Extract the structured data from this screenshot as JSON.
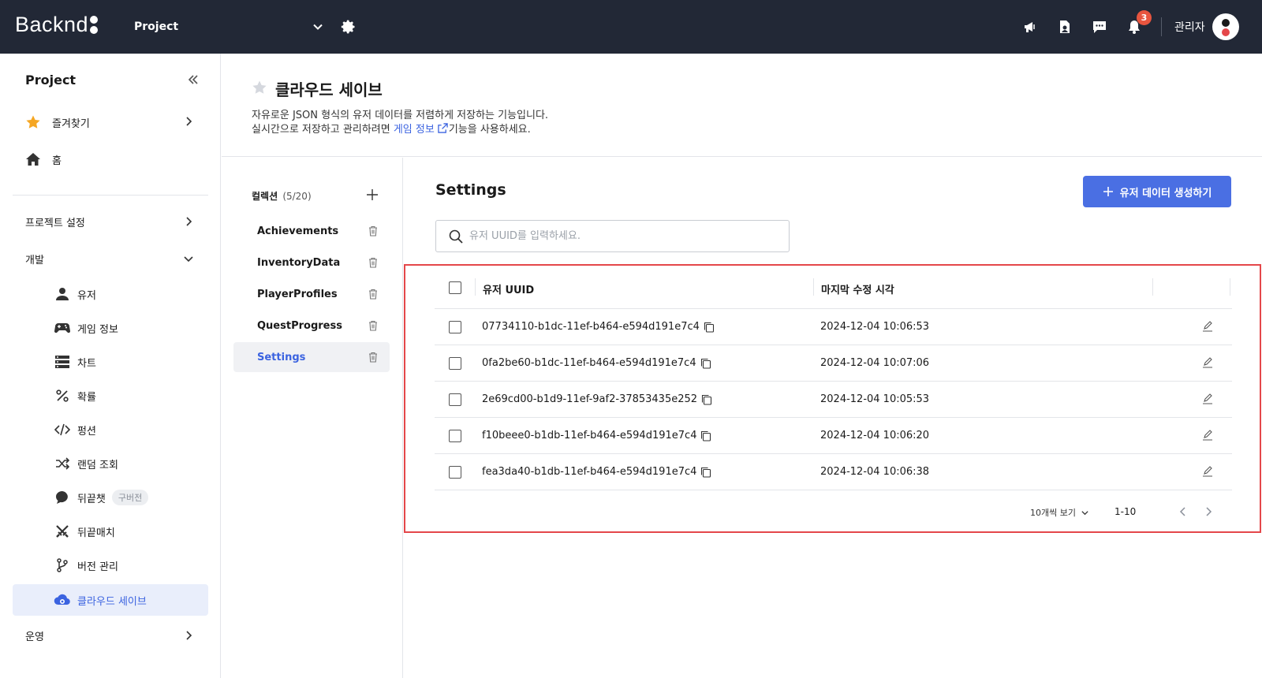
{
  "topbar": {
    "logo_text": "Backnd",
    "project_name": "Project",
    "notification_count": "3",
    "admin_label": "관리자"
  },
  "sidebar": {
    "title": "Project",
    "favorites": "즐겨찾기",
    "home": "홈",
    "project_settings": "프로젝트 설정",
    "dev_section": "개발",
    "dev_items": [
      {
        "label": "유저",
        "icon": "user-icon"
      },
      {
        "label": "게임 정보",
        "icon": "gamepad-icon"
      },
      {
        "label": "차트",
        "icon": "chart-icon"
      },
      {
        "label": "확률",
        "icon": "percent-icon"
      },
      {
        "label": "펑션",
        "icon": "code-icon"
      },
      {
        "label": "랜덤 조회",
        "icon": "shuffle-icon"
      },
      {
        "label": "뒤끝챗",
        "icon": "chat-bubble-icon",
        "badge": "구버전"
      },
      {
        "label": "뒤끝매치",
        "icon": "swords-icon"
      },
      {
        "label": "버전 관리",
        "icon": "branch-icon"
      },
      {
        "label": "클라우드 세이브",
        "icon": "cloud-icon",
        "active": true
      }
    ],
    "ops_section": "운영"
  },
  "page": {
    "title": "클라우드 세이브",
    "desc_line1": "자유로운 JSON 형식의 유저 데이터를 저렴하게 저장하는 기능입니다.",
    "desc_line2_prefix": "실시간으로 저장하고 관리하려면 ",
    "desc_link": "게임 정보",
    "desc_line2_suffix": "기능을 사용하세요."
  },
  "collections": {
    "label": "컬렉션",
    "count": "(5/20)",
    "items": [
      {
        "name": "Achievements"
      },
      {
        "name": "InventoryData"
      },
      {
        "name": "PlayerProfiles"
      },
      {
        "name": "QuestProgress"
      },
      {
        "name": "Settings",
        "active": true
      }
    ]
  },
  "content": {
    "title": "Settings",
    "create_button": "유저 데이터 생성하기",
    "search_placeholder": "유저 UUID를 입력하세요.",
    "col_uuid": "유저 UUID",
    "col_modified": "마지막 수정 시각",
    "rows": [
      {
        "uuid": "07734110-b1dc-11ef-b464-e594d191e7c4",
        "modified": "2024-12-04 10:06:53"
      },
      {
        "uuid": "0fa2be60-b1dc-11ef-b464-e594d191e7c4",
        "modified": "2024-12-04 10:07:06"
      },
      {
        "uuid": "2e69cd00-b1d9-11ef-9af2-37853435e252",
        "modified": "2024-12-04 10:05:53"
      },
      {
        "uuid": "f10beee0-b1db-11ef-b464-e594d191e7c4",
        "modified": "2024-12-04 10:06:20"
      },
      {
        "uuid": "fea3da40-b1db-11ef-b464-e594d191e7c4",
        "modified": "2024-12-04 10:06:38"
      }
    ],
    "page_size": "10개씩 보기",
    "range": "1-10"
  },
  "colors": {
    "topbar_bg": "#222836",
    "accent": "#4a6fe3",
    "highlight_border": "#e4474a",
    "badge": "#e8553f"
  }
}
